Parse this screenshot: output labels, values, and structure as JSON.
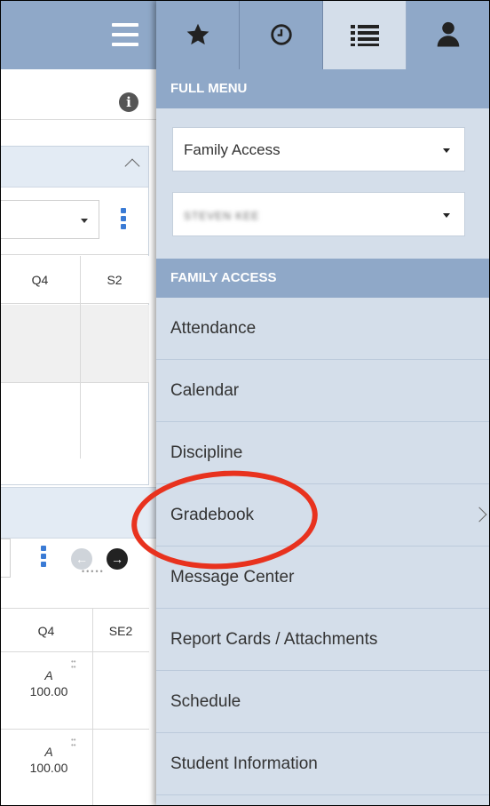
{
  "background_panel": {
    "grid1": {
      "headers": [
        "Q4",
        "S2"
      ]
    },
    "grid2": {
      "headers": [
        "Q4",
        "SE2"
      ],
      "rows": [
        {
          "letter": "A",
          "score": "100.00"
        },
        {
          "letter": "A",
          "score": "100.00"
        }
      ]
    }
  },
  "menu": {
    "tabs": [
      {
        "icon": "star-icon",
        "label": "favorites"
      },
      {
        "icon": "clock-icon",
        "label": "recent"
      },
      {
        "icon": "list-icon",
        "label": "full menu",
        "active": true
      },
      {
        "icon": "user-icon",
        "label": "account"
      }
    ],
    "full_menu_heading": "FULL MENU",
    "application_select": "Family Access",
    "student_select": "STEVEN KEE",
    "family_access_heading": "FAMILY ACCESS",
    "items": [
      {
        "label": "Attendance"
      },
      {
        "label": "Calendar"
      },
      {
        "label": "Discipline"
      },
      {
        "label": "Gradebook",
        "has_submenu": true
      },
      {
        "label": "Message Center"
      },
      {
        "label": "Report Cards / Attachments"
      },
      {
        "label": "Schedule"
      },
      {
        "label": "Student Information"
      }
    ]
  },
  "colors": {
    "header_blue": "#8fa8c8",
    "menu_bg": "#d4deea",
    "highlight_circle": "#e8321e",
    "kebab_blue": "#3a7bd5"
  }
}
